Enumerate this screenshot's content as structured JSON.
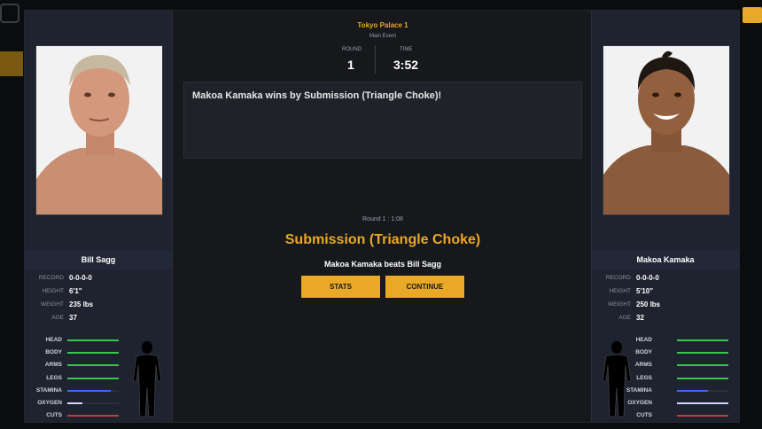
{
  "venue": "Tokyo Palace 1",
  "event": "Main Event",
  "round": {
    "label": "ROUND",
    "value": "1"
  },
  "time": {
    "label": "TIME",
    "value": "3:52"
  },
  "log_message": "Makoa Kamaka wins by Submission (Triangle Choke)!",
  "round_time": "Round 1 : 1:08",
  "result": "Submission (Triangle Choke)",
  "beats": "Makoa Kamaka beats Bill Sagg",
  "buttons": {
    "stats": "STATS",
    "continue": "CONTINUE"
  },
  "stat_labels": {
    "record": "RECORD",
    "height": "HEIGHT",
    "weight": "WEIGHT",
    "age": "AGE"
  },
  "body_labels": {
    "head": "HEAD",
    "body": "BODY",
    "arms": "ARMS",
    "legs": "LEGS",
    "stamina": "STAMINA",
    "oxygen": "OXYGEN",
    "cuts": "CUTS"
  },
  "bar_colors": {
    "head": "#35c84a",
    "body": "#35c84a",
    "arms": "#35c84a",
    "legs": "#35c84a",
    "stamina": "#2f6cff",
    "oxygen": "#cfd6ff",
    "cuts": "#c83a3a"
  },
  "fighters": {
    "left": {
      "name": "Bill Sagg",
      "record": "0-0-0-0",
      "height": "6'1\"",
      "weight": "235 lbs",
      "age": "37",
      "bars": {
        "head": 1.0,
        "body": 1.0,
        "arms": 1.0,
        "legs": 1.0,
        "stamina": 0.85,
        "oxygen": 0.3,
        "cuts": 1.0
      }
    },
    "right": {
      "name": "Makoa Kamaka",
      "record": "0-0-0-0",
      "height": "5'10\"",
      "weight": "250 lbs",
      "age": "32",
      "bars": {
        "head": 1.0,
        "body": 1.0,
        "arms": 1.0,
        "legs": 1.0,
        "stamina": 0.6,
        "oxygen": 1.0,
        "cuts": 1.0
      }
    }
  }
}
